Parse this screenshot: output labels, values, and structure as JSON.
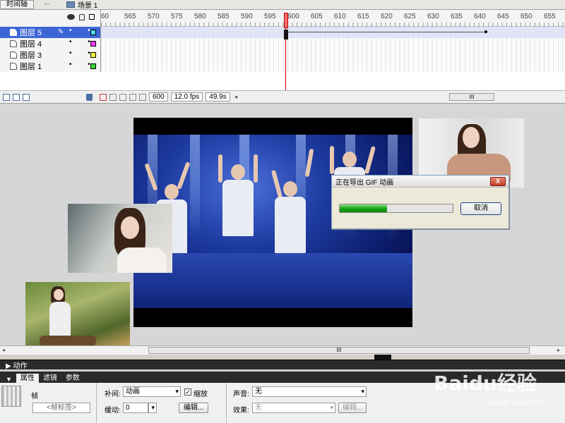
{
  "topbar": {
    "timeline_tab": "时间轴",
    "back_arrow": "⇦",
    "scene_label": "场景 1"
  },
  "timeline": {
    "ruler_ticks": [
      "60",
      "565",
      "570",
      "575",
      "580",
      "585",
      "590",
      "595",
      "600",
      "605",
      "610",
      "615",
      "620",
      "625",
      "630",
      "635",
      "640",
      "645",
      "650",
      "655"
    ],
    "layers": [
      {
        "name": "图层 5",
        "color": "#4fd6f5",
        "selected": true
      },
      {
        "name": "图层 4",
        "color": "#f23af5",
        "selected": false
      },
      {
        "name": "图层 3",
        "color": "#f5f53a",
        "selected": false
      },
      {
        "name": "图层 1",
        "color": "#38d638",
        "selected": false
      }
    ],
    "dots": "•  •",
    "footer": {
      "frame": "600",
      "fps": "12.0 fps",
      "time": "49.9s",
      "scroll_thumb": "III"
    }
  },
  "dialog": {
    "title": "正在导出 GIF 动画",
    "close_label": "X",
    "progress": 0.42,
    "cancel_label": "取消"
  },
  "stage_scroll": {
    "thumb": "III",
    "left_arrow": "◂",
    "right_arrow": "▸"
  },
  "panels": {
    "actions_label": "▶ 动作",
    "tabs": [
      "属性",
      "滤镜",
      "参数"
    ],
    "frame_label": "帧",
    "frame_label_placeholder": "<帧标签>",
    "tween_label": "补间:",
    "tween_value": "动画",
    "scale_label": "缩放",
    "ease_label": "缓动:",
    "ease_value": "0",
    "edit_label": "编辑...",
    "sound_label": "声音:",
    "sound_value": "无",
    "effect_label": "效果:",
    "effect_value": "无",
    "edit2_label": "编辑..."
  },
  "watermark": {
    "brand": "Baidu经验",
    "url": "jingyan.baidu.com"
  }
}
